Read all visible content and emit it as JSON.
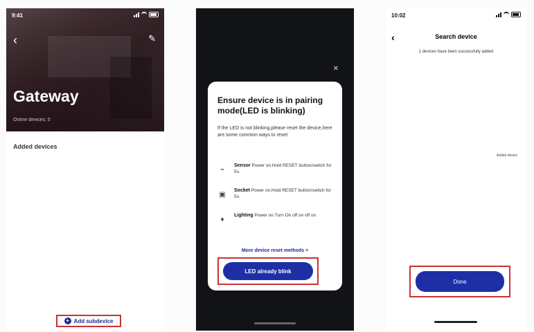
{
  "phone1": {
    "status_time": "9:41",
    "title": "Gateway",
    "subtitle": "Online devices: 0",
    "section_title": "Added devices",
    "add_button": "Add subdevice"
  },
  "phone2": {
    "modal_title": "Ensure device is in pairing mode(LED is blinking)",
    "modal_desc": "If the LED is not blinking,please reset the device,here are some common ways to reset",
    "devices": [
      {
        "name": "Sensor",
        "text": "Power on.Hold RESET button/switch for 5s."
      },
      {
        "name": "Socket",
        "text": "Power on.Hold RESET button/switch for 5s."
      },
      {
        "name": "Lighting",
        "text": "Power on.Turn On off on off on"
      }
    ],
    "more_link": "More device reset methods >",
    "confirm_button": "LED already blink"
  },
  "phone3": {
    "status_time": "10:02",
    "nav_title": "Search device",
    "subtitle": "1 devices have been successfully added",
    "side_note": "Added device",
    "done_button": "Done"
  }
}
